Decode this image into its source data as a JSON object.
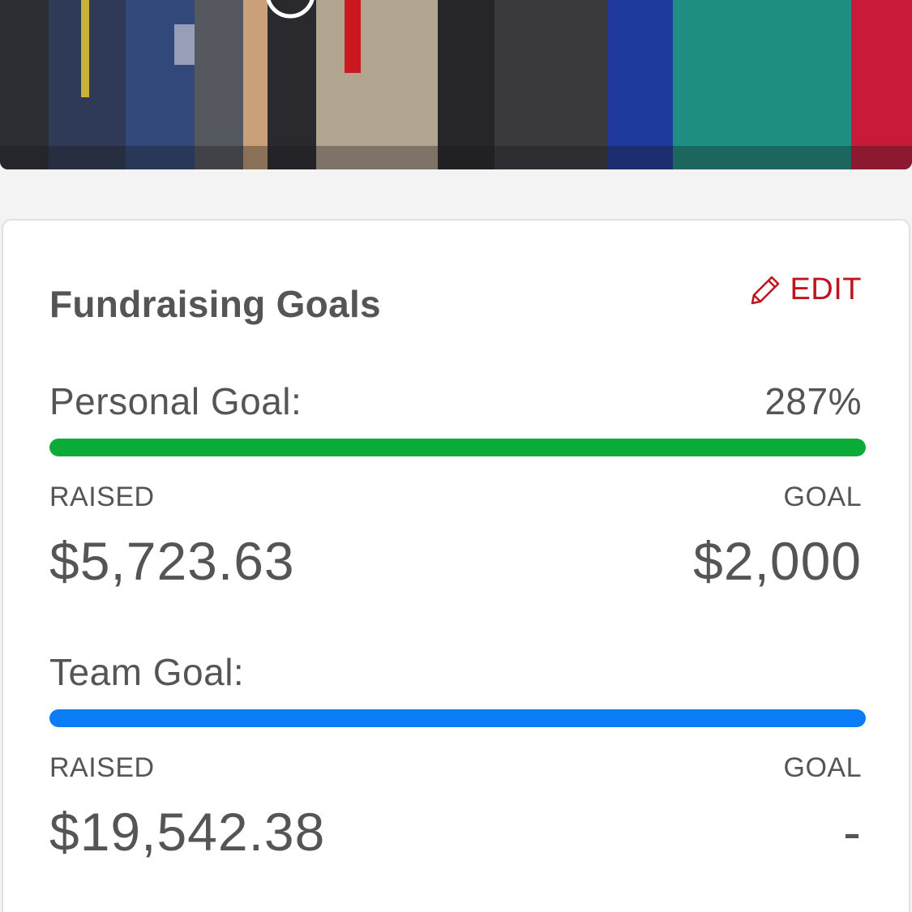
{
  "card": {
    "title": "Fundraising Goals",
    "edit_label": "EDIT"
  },
  "personal_goal": {
    "label": "Personal Goal:",
    "percent_text": "287%",
    "progress_fraction": 1.0,
    "raised_caption": "RAISED",
    "goal_caption": "GOAL",
    "raised_amount": "$5,723.63",
    "goal_amount": "$2,000",
    "bar_color": "#0aab36"
  },
  "team_goal": {
    "label": "Team Goal:",
    "progress_fraction": 1.0,
    "raised_caption": "RAISED",
    "goal_caption": "GOAL",
    "raised_amount": "$19,542.38",
    "goal_amount": "-",
    "bar_color": "#0a7cf5"
  },
  "colors": {
    "accent_red": "#c0141e",
    "text_gray": "#555555",
    "page_bg": "#f3f3f3"
  },
  "icons": {
    "edit": "pencil-icon"
  }
}
